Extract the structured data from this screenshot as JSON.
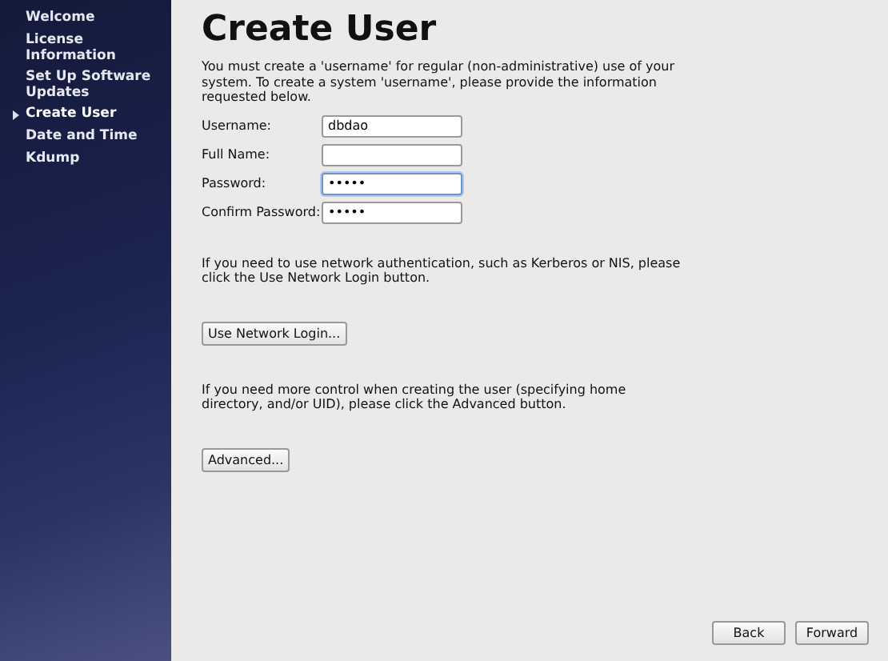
{
  "sidebar": {
    "items": [
      {
        "label": "Welcome",
        "selected": false
      },
      {
        "label": "License Information",
        "selected": false
      },
      {
        "label": "Set Up Software Updates",
        "selected": false
      },
      {
        "label": "Create User",
        "selected": true
      },
      {
        "label": "Date and Time",
        "selected": false
      },
      {
        "label": "Kdump",
        "selected": false
      }
    ]
  },
  "title": "Create User",
  "intro": "You must create a 'username' for regular (non-administrative) use of your system.  To create a system 'username', please provide the information requested below.",
  "fields": [
    {
      "label": "Username:",
      "value": "dbdao",
      "focused": false
    },
    {
      "label": "Full Name:",
      "focused": false
    },
    {
      "label": "Password:",
      "value": "•••••",
      "focused": true
    },
    {
      "label": "Confirm Password:",
      "value": "•••••",
      "focused": false
    }
  ],
  "network_text": "If you need to use network authentication, such as Kerberos or NIS, please click the Use Network Login button.",
  "network_button": "Use Network Login...",
  "advanced_text": "If you need more control when creating the user (specifying home directory, and/or UID), please click the Advanced button.",
  "advanced_button": "Advanced...",
  "nav_buttons": [
    "Back",
    "Forward"
  ]
}
